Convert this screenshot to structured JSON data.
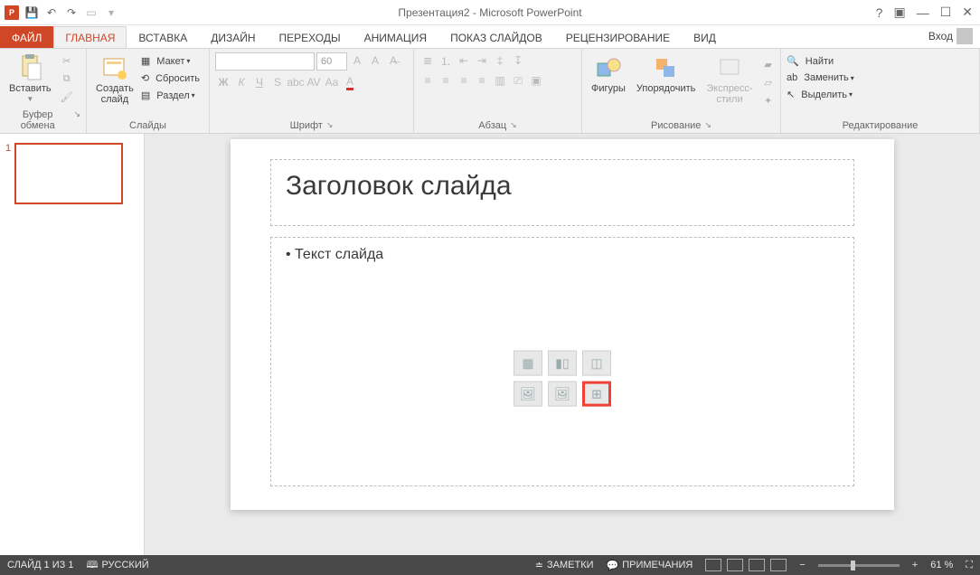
{
  "titlebar": {
    "title": "Презентация2 - Microsoft PowerPoint"
  },
  "tabs": {
    "file": "ФАЙЛ",
    "home": "ГЛАВНАЯ",
    "insert": "ВСТАВКА",
    "design": "ДИЗАЙН",
    "transitions": "ПЕРЕХОДЫ",
    "animations": "АНИМАЦИЯ",
    "slideshow": "ПОКАЗ СЛАЙДОВ",
    "review": "РЕЦЕНЗИРОВАНИЕ",
    "view": "ВИД",
    "signin": "Вход"
  },
  "ribbon": {
    "clipboard": {
      "paste": "Вставить",
      "label": "Буфер обмена"
    },
    "slides": {
      "newslide": "Создать\nслайд",
      "layout": "Макет",
      "reset": "Сбросить",
      "section": "Раздел",
      "label": "Слайды"
    },
    "font": {
      "size": "60",
      "label": "Шрифт"
    },
    "paragraph": {
      "label": "Абзац"
    },
    "drawing": {
      "shapes": "Фигуры",
      "arrange": "Упорядочить",
      "styles": "Экспресс-\nстили",
      "label": "Рисование"
    },
    "editing": {
      "find": "Найти",
      "replace": "Заменить",
      "select": "Выделить",
      "label": "Редактирование"
    }
  },
  "thumb": {
    "num": "1"
  },
  "slide": {
    "title": "Заголовок слайда",
    "body": "• Текст слайда"
  },
  "status": {
    "slidecount": "СЛАЙД 1 ИЗ 1",
    "lang": "РУССКИЙ",
    "notes": "ЗАМЕТКИ",
    "comments": "ПРИМЕЧАНИЯ",
    "zoom": "61 %"
  }
}
